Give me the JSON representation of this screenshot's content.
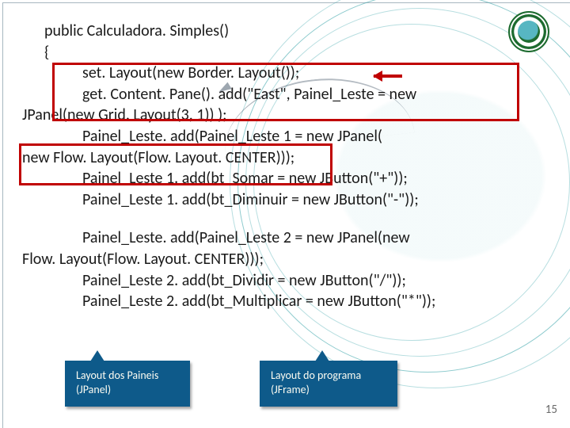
{
  "code": {
    "l1": "public Calculadora. Simples()",
    "l2": "{",
    "l3": "set. Layout(new Border. Layout());",
    "l4a": "get. Content. Pane(). add(\"East\", Painel_Leste = new",
    "l4b": "JPanel(new Grid. Layout(3, 1)) );",
    "l5a": "Painel_Leste. add(Painel_Leste 1 = new JPanel(",
    "l5b": "new Flow. Layout(Flow. Layout. CENTER)));",
    "l6": "Painel_Leste 1. add(bt_Somar = new JButton(\"+\"));",
    "l7": "Painel_Leste 1. add(bt_Diminuir = new JButton(\"-\"));",
    "l8a": "Painel_Leste. add(Painel_Leste 2 = new JPanel(new",
    "l8b": "Flow. Layout(Flow. Layout. CENTER)));",
    "l9": "Painel_Leste 2. add(bt_Dividir = new JButton(\"/\"));",
    "l10": "Painel_Leste 2. add(bt_Multiplicar = new JButton(\"*\"));"
  },
  "callouts": {
    "panel": {
      "line1": "Layout dos Paineis",
      "line2": "(JPanel)"
    },
    "program": {
      "line1": "Layout do programa",
      "line2": "(JFrame)"
    }
  },
  "page_number": "15",
  "colors": {
    "highlight": "#c00000",
    "callout_bg": "#0e5a8a"
  }
}
